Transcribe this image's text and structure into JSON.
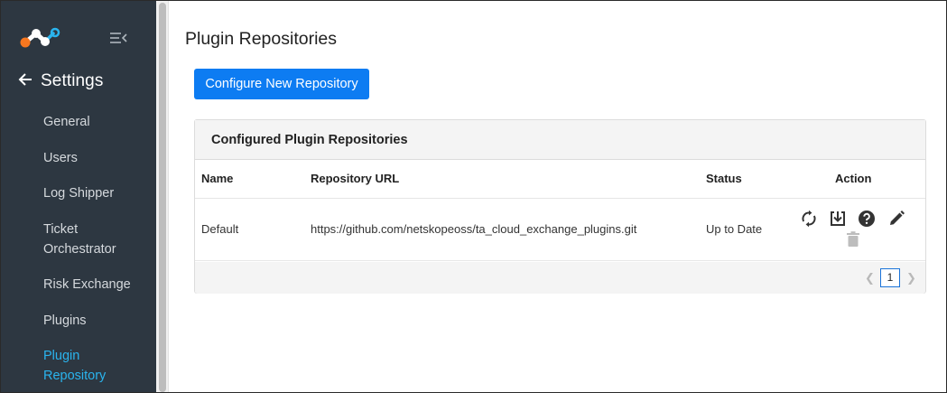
{
  "sidebar": {
    "back_label": "Settings",
    "items": [
      {
        "label": "General",
        "active": false
      },
      {
        "label": "Users",
        "active": false
      },
      {
        "label": "Log Shipper",
        "active": false
      },
      {
        "label": "Ticket\nOrchestrator",
        "active": false
      },
      {
        "label": "Risk Exchange",
        "active": false
      },
      {
        "label": "Plugins",
        "active": false
      },
      {
        "label": "Plugin\nRepository",
        "active": true
      }
    ]
  },
  "page": {
    "title": "Plugin Repositories",
    "configure_button": "Configure New Repository"
  },
  "card": {
    "title": "Configured Plugin Repositories",
    "columns": [
      "Name",
      "Repository URL",
      "Status",
      "Action"
    ],
    "rows": [
      {
        "name": "Default",
        "url": "https://github.com/netskopeoss/ta_cloud_exchange_plugins.git",
        "status": "Up to Date",
        "actions": [
          "sync-icon",
          "download-icon",
          "help-icon",
          "edit-icon",
          "delete-icon"
        ]
      }
    ]
  },
  "pagination": {
    "current_page": "1",
    "prev_icon": "chevron-left-icon",
    "next_icon": "chevron-right-icon"
  },
  "colors": {
    "sidebar_bg": "#2d3741",
    "active_nav": "#2ab4ee",
    "primary_button": "#0d7cf2",
    "logo_orange": "#f7771f",
    "logo_blue": "#2ab4ee"
  }
}
